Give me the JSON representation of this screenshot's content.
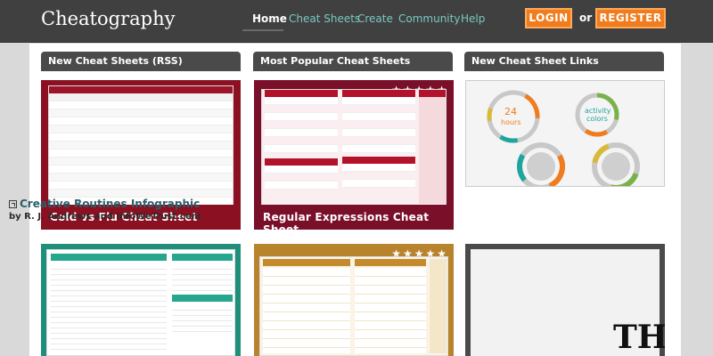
{
  "header": {
    "logo": "Cheatography",
    "nav": [
      "Home",
      "Cheat Sheets",
      "Create",
      "Community",
      "Help"
    ],
    "login": "LOGIN",
    "or": "or",
    "register": "REGISTER"
  },
  "columns": [
    "New Cheat Sheets (RSS)",
    "Most Popular Cheat Sheets",
    "New Cheat Sheet Links"
  ],
  "cards": {
    "cold_flu": "Cold vs Flu Cheat Sheet",
    "regex": "Regular Expressions Cheat Sheet",
    "link_title": "Creative Routines Infographic",
    "link_by": "by R. J. Andrews and InfoWeTrust.com"
  },
  "preview_big_text": "TH",
  "colors": {
    "accent": "#f07c1e",
    "maroon": "#8a1022",
    "red": "#b3122b",
    "teal": "#1f8f7c",
    "gold": "#b8832d"
  }
}
